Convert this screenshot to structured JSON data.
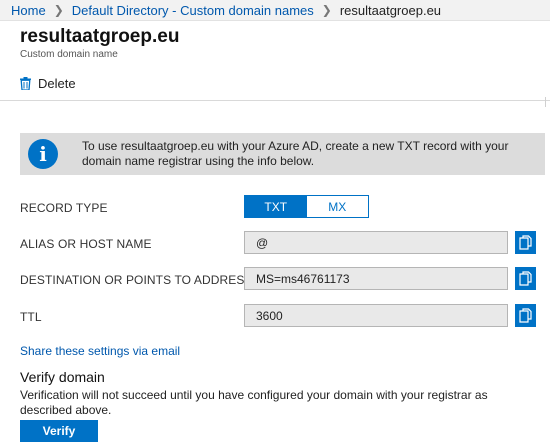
{
  "breadcrumb": {
    "items": [
      "Home",
      "Default Directory - Custom domain names"
    ],
    "current": "resultaatgroep.eu"
  },
  "header": {
    "title": "resultaatgroep.eu",
    "subtitle": "Custom domain name"
  },
  "toolbar": {
    "delete_label": "Delete"
  },
  "info": {
    "line1": "To use resultaatgroep.eu with your Azure AD, create a new TXT record with your",
    "line2": "domain name registrar using the info below."
  },
  "record_type": {
    "label": "RECORD TYPE",
    "options": [
      "TXT",
      "MX"
    ],
    "selected": "TXT"
  },
  "fields": [
    {
      "label": "ALIAS OR HOST NAME",
      "value": "@"
    },
    {
      "label": "DESTINATION OR POINTS TO ADDRESS",
      "value": "MS=ms46761173"
    },
    {
      "label": "TTL",
      "value": "3600"
    }
  ],
  "share_link": "Share these settings via email",
  "verify": {
    "heading": "Verify domain",
    "line1": "Verification will not succeed until you have configured your domain with your registrar as",
    "line2": "described above.",
    "button_label": "Verify"
  },
  "colors": {
    "accent": "#0072c6",
    "link": "#0058ad",
    "banner_bg": "#dcdcdc"
  },
  "icons": {
    "delete": "trash-icon",
    "info": "info-icon",
    "copy": "copy-icon",
    "separator": "chevron-right-icon"
  }
}
